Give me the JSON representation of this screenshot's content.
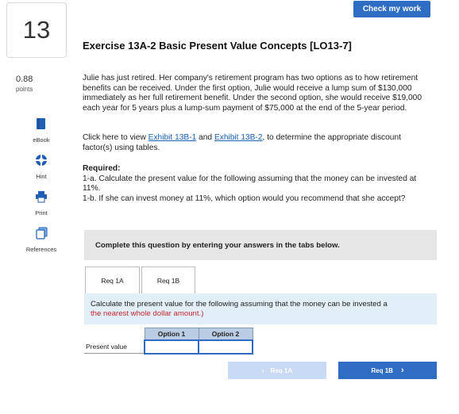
{
  "header": {
    "check_label": "Check my work"
  },
  "question": {
    "number": "13",
    "points_value": "0.88",
    "points_label": "points"
  },
  "tools": [
    {
      "label": "eBook",
      "icon": "book-icon"
    },
    {
      "label": "Hint",
      "icon": "lifebuoy-icon"
    },
    {
      "label": "Print",
      "icon": "printer-icon"
    },
    {
      "label": "References",
      "icon": "references-icon"
    }
  ],
  "exercise": {
    "title": "Exercise 13A-2 Basic Present Value Concepts [LO13-7]",
    "intro": "Julie has just retired. Her company's retirement program has two options as to how retirement benefits can be received. Under the first option, Julie would receive a lump sum of $130,000 immediately as her full retirement benefit. Under the second option, she would receive $19,000 each year for 5 years plus a lump-sum payment of $75,000 at the end of the 5-year period.",
    "exhibit_prefix": "Click here to view ",
    "exhibit_1": "Exhibit 13B-1",
    "exhibit_and": " and ",
    "exhibit_2": "Exhibit 13B-2",
    "exhibit_suffix": ", to determine the appropriate discount factor(s) using tables.",
    "required_heading": "Required:",
    "req_1a": "1-a. Calculate the present value for the following assuming that the money can be invested at 11%.",
    "req_1b": "1-b. If she can invest money at 11%, which option would you recommend that she accept?"
  },
  "instructions": "Complete this question by entering your answers in the tabs below.",
  "tabs": [
    {
      "label": "Req 1A"
    },
    {
      "label": "Req 1B"
    }
  ],
  "panel": {
    "text": "Calculate the present value for the following assuming that the money can be invested a",
    "red_text": "the nearest whole dollar amount.)"
  },
  "table": {
    "columns": [
      "Option 1",
      "Option 2"
    ],
    "row_label": "Present value",
    "values": [
      "",
      ""
    ]
  },
  "nav": {
    "prev_label": "Req 1A",
    "next_label": "Req 1B"
  }
}
